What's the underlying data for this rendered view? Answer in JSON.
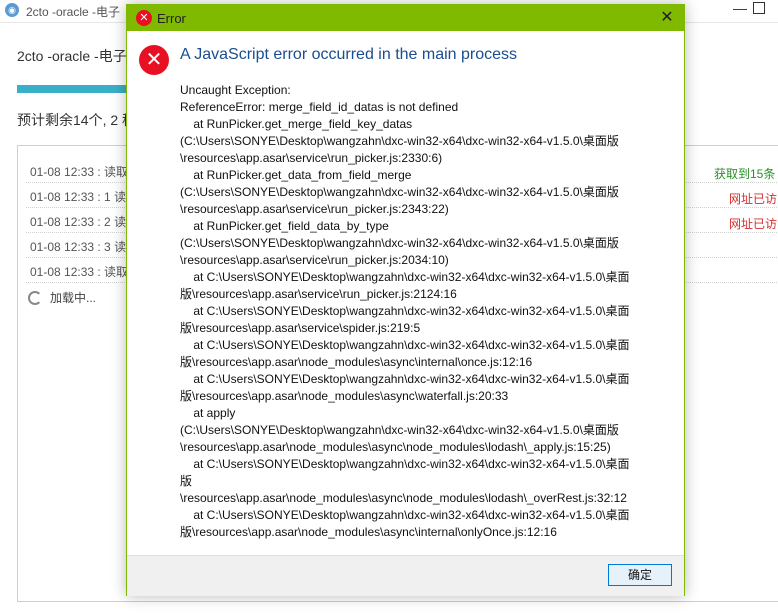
{
  "app": {
    "title": "2cto -oracle -电子",
    "icon": "app-logo-icon",
    "header": "2cto -oracle -电子",
    "progress": 1.0,
    "remaining": "预计剩余14个, 2 秒",
    "log": [
      {
        "text": "01-08 12:33 : 读取"
      },
      {
        "text": "01-08 12:33 : 1 读"
      },
      {
        "text": "01-08 12:33 : 2 读"
      },
      {
        "text": "01-08 12:33 : 3 读"
      },
      {
        "text": "01-08 12:33 : 读取"
      }
    ],
    "loading": "加载中...",
    "right_status": [
      "获取到15条",
      "网址已访",
      "网址已访"
    ]
  },
  "dialog": {
    "title": "Error",
    "heading": "A JavaScript error occurred in the main process",
    "message": "Uncaught Exception:\nReferenceError: merge_field_id_datas is not defined\n    at RunPicker.get_merge_field_key_datas\n(C:\\Users\\SONYE\\Desktop\\wangzahn\\dxc-win32-x64\\dxc-win32-x64-v1.5.0\\桌面版\n\\resources\\app.asar\\service\\run_picker.js:2330:6)\n    at RunPicker.get_data_from_field_merge\n(C:\\Users\\SONYE\\Desktop\\wangzahn\\dxc-win32-x64\\dxc-win32-x64-v1.5.0\\桌面版\n\\resources\\app.asar\\service\\run_picker.js:2343:22)\n    at RunPicker.get_field_data_by_type\n(C:\\Users\\SONYE\\Desktop\\wangzahn\\dxc-win32-x64\\dxc-win32-x64-v1.5.0\\桌面版\n\\resources\\app.asar\\service\\run_picker.js:2034:10)\n    at C:\\Users\\SONYE\\Desktop\\wangzahn\\dxc-win32-x64\\dxc-win32-x64-v1.5.0\\桌面\n版\\resources\\app.asar\\service\\run_picker.js:2124:16\n    at C:\\Users\\SONYE\\Desktop\\wangzahn\\dxc-win32-x64\\dxc-win32-x64-v1.5.0\\桌面\n版\\resources\\app.asar\\service\\spider.js:219:5\n    at C:\\Users\\SONYE\\Desktop\\wangzahn\\dxc-win32-x64\\dxc-win32-x64-v1.5.0\\桌面\n版\\resources\\app.asar\\node_modules\\async\\internal\\once.js:12:16\n    at C:\\Users\\SONYE\\Desktop\\wangzahn\\dxc-win32-x64\\dxc-win32-x64-v1.5.0\\桌面\n版\\resources\\app.asar\\node_modules\\async\\waterfall.js:20:33\n    at apply\n(C:\\Users\\SONYE\\Desktop\\wangzahn\\dxc-win32-x64\\dxc-win32-x64-v1.5.0\\桌面版\n\\resources\\app.asar\\node_modules\\async\\node_modules\\lodash\\_apply.js:15:25)\n    at C:\\Users\\SONYE\\Desktop\\wangzahn\\dxc-win32-x64\\dxc-win32-x64-v1.5.0\\桌面\n版\n\\resources\\app.asar\\node_modules\\async\\node_modules\\lodash\\_overRest.js:32:12\n    at C:\\Users\\SONYE\\Desktop\\wangzahn\\dxc-win32-x64\\dxc-win32-x64-v1.5.0\\桌面\n版\\resources\\app.asar\\node_modules\\async\\internal\\onlyOnce.js:12:16",
    "ok_label": "确定",
    "accent_color": "#7fba00",
    "error_color": "#e81123"
  }
}
